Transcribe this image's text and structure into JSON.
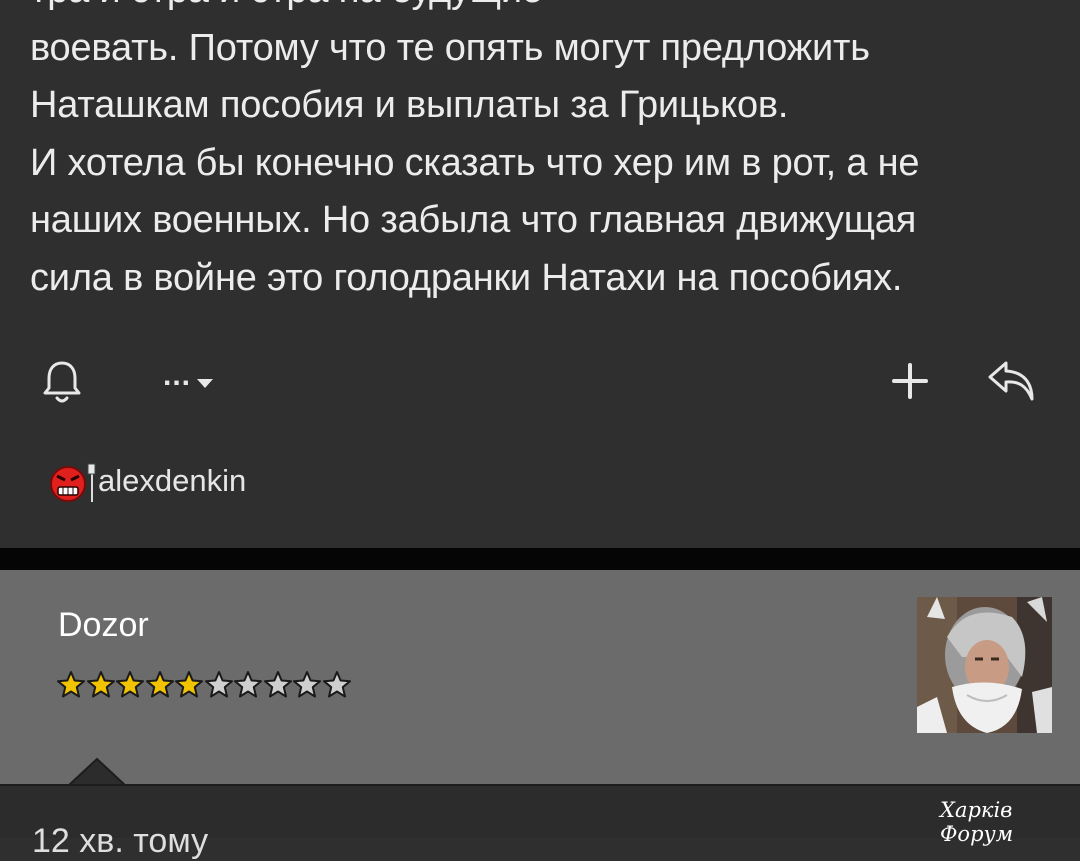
{
  "post": {
    "lines": [
      "тра и стра и стра на будущие",
      "воевать. Потому что те опять могут предложить",
      "Наташкам пособия и выплаты за Грицьков.",
      "И хотела бы конечно сказать что хер им в рот, а не",
      "наших военных. Но забыла что главная движущая",
      "сила в войне это голодранки Натахи на пособиях."
    ],
    "signature": "alexdenkin"
  },
  "actions": {
    "bell_icon": "bell-icon",
    "more_label": "...",
    "add_icon": "plus-icon",
    "reply_icon": "reply-icon"
  },
  "next_post": {
    "author": "Dozor",
    "rating": {
      "filled": 5,
      "total": 10
    },
    "time": "12 хв. тому"
  },
  "watermark": "Харків Форум",
  "colors": {
    "background": "#2f2f2f",
    "author_panel": "#6b6b6b",
    "divider": "#050505",
    "star_filled": "#f2c300",
    "star_empty": "#cfcfcf"
  }
}
